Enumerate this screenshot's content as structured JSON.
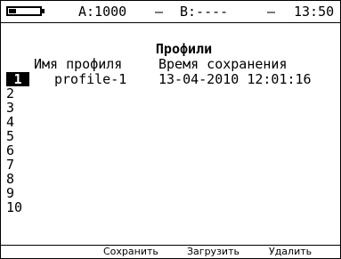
{
  "status": {
    "battery_level": 0.25,
    "a_label": "A:1000",
    "dash1": "–",
    "b_label": "B:----",
    "dash2": "–",
    "time": "13:50"
  },
  "screen": {
    "title": "Профили",
    "columns": {
      "name": "Имя профиля",
      "time": "Время сохранения"
    },
    "rows": [
      {
        "num": "1",
        "name": "profile-1",
        "time": "13-04-2010 12:01:16",
        "selected": true
      },
      {
        "num": "2",
        "name": "",
        "time": ""
      },
      {
        "num": "3",
        "name": "",
        "time": ""
      },
      {
        "num": "4",
        "name": "",
        "time": ""
      },
      {
        "num": "5",
        "name": "",
        "time": ""
      },
      {
        "num": "6",
        "name": "",
        "time": ""
      },
      {
        "num": "7",
        "name": "",
        "time": ""
      },
      {
        "num": "8",
        "name": "",
        "time": ""
      },
      {
        "num": "9",
        "name": "",
        "time": ""
      },
      {
        "num": "10",
        "name": "",
        "time": ""
      }
    ]
  },
  "funcbar": {
    "save": "Сохранить",
    "load": "Загрузить",
    "delete": "Удалить"
  }
}
